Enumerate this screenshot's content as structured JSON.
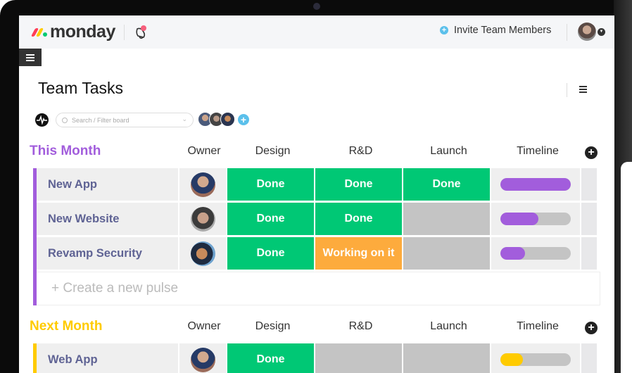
{
  "app": {
    "brand": "monday",
    "logo_colors": [
      "#ff3d57",
      "#ffcb00",
      "#00ca72"
    ],
    "notification_dot_color": "#f65f7c"
  },
  "topbar": {
    "invite_label": "Invite Team Members",
    "menu_icon": "hamburger-icon"
  },
  "board": {
    "title": "Team Tasks",
    "search_placeholder": "Search / Filter board",
    "member_count": 3
  },
  "columns": [
    "Owner",
    "Design",
    "R&D",
    "Launch",
    "Timeline"
  ],
  "status_colors": {
    "Done": "#00c875",
    "Working on it": "#fdab3d",
    "empty": "#c4c4c4"
  },
  "groups": [
    {
      "title": "This Month",
      "color": "#a25ddc",
      "rows": [
        {
          "name": "New App",
          "design": "Done",
          "rnd": "Done",
          "launch": "Done",
          "timeline_progress": 1.0
        },
        {
          "name": "New Website",
          "design": "Done",
          "rnd": "Done",
          "launch": "",
          "timeline_progress": 0.54
        },
        {
          "name": "Revamp Security",
          "design": "Done",
          "rnd": "Working on it",
          "launch": "",
          "timeline_progress": 0.35
        }
      ],
      "create_placeholder": "+ Create a new pulse"
    },
    {
      "title": "Next Month",
      "color": "#ffcb00",
      "rows": [
        {
          "name": "Web App",
          "design": "Done",
          "rnd": "",
          "launch": "",
          "timeline_progress": 0.32
        }
      ]
    }
  ]
}
